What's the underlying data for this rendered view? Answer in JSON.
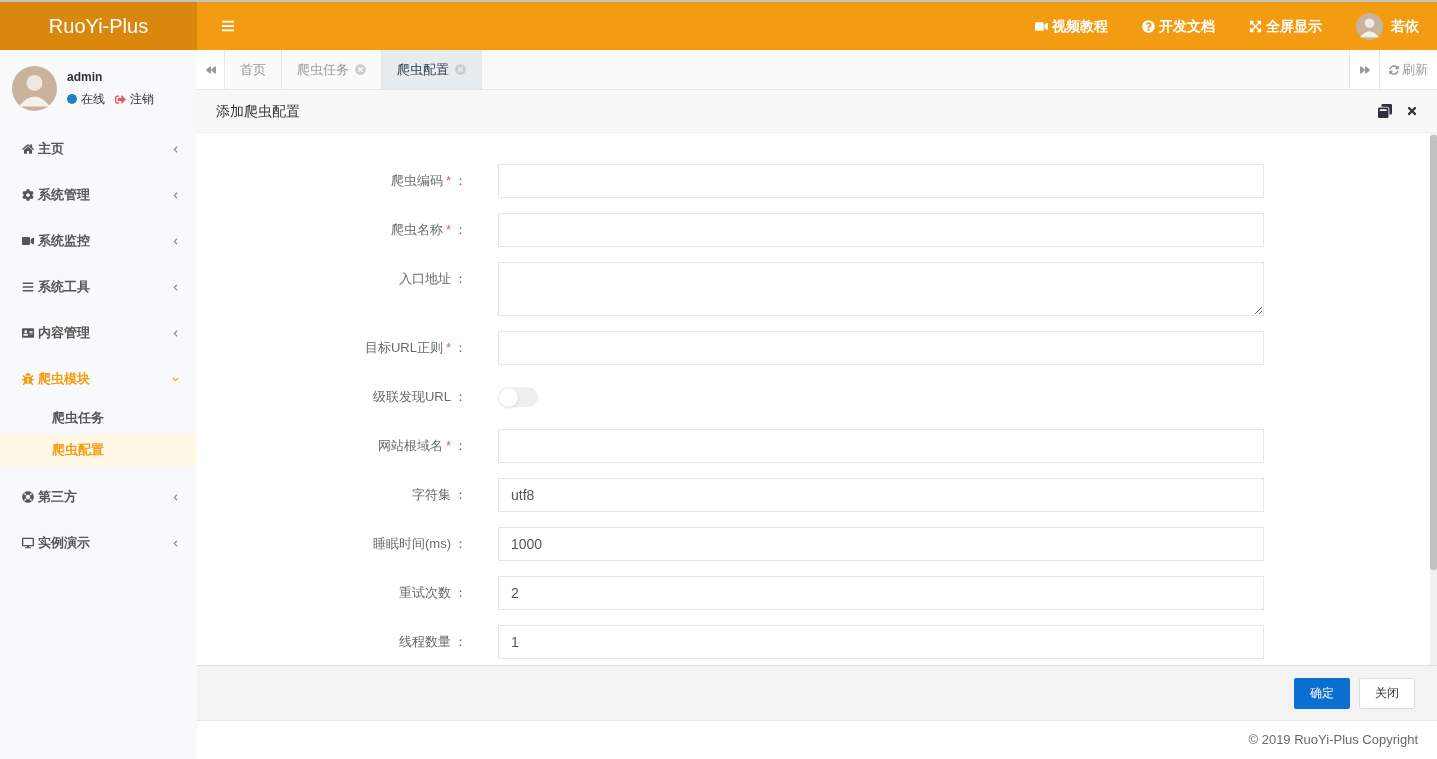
{
  "logo": "RuoYi-Plus",
  "top_menu": [
    {
      "label": "视频教程"
    },
    {
      "label": "开发文档"
    },
    {
      "label": "全屏显示"
    }
  ],
  "top_user": "若依",
  "user": {
    "name": "admin",
    "status": "在线",
    "logout": "注销"
  },
  "sidebar": [
    {
      "label": "主页",
      "expanded": false
    },
    {
      "label": "系统管理",
      "expanded": false
    },
    {
      "label": "系统监控",
      "expanded": false
    },
    {
      "label": "系统工具",
      "expanded": false
    },
    {
      "label": "内容管理",
      "expanded": false
    },
    {
      "label": "爬虫模块",
      "expanded": true,
      "children": [
        {
          "label": "爬虫任务",
          "selected": false
        },
        {
          "label": "爬虫配置",
          "selected": true
        }
      ]
    },
    {
      "label": "第三方",
      "expanded": false
    },
    {
      "label": "实例演示",
      "expanded": false
    }
  ],
  "tabs": [
    {
      "label": "首页",
      "closable": false,
      "selected": false
    },
    {
      "label": "爬虫任务",
      "closable": true,
      "selected": false
    },
    {
      "label": "爬虫配置",
      "closable": true,
      "selected": true
    }
  ],
  "refresh": "刷新",
  "dialog": {
    "title": "添加爬虫配置",
    "fields": [
      {
        "kind": "input",
        "label": "爬虫编码",
        "required_mark": "*",
        "colon": "："
      },
      {
        "kind": "input",
        "label": "爬虫名称",
        "required_mark": "*",
        "colon": "："
      },
      {
        "kind": "textarea",
        "label": "入口地址",
        "colon": "："
      },
      {
        "kind": "input",
        "label": "目标URL正则",
        "required_mark": "*",
        "colon": "："
      },
      {
        "kind": "switch",
        "label": "级联发现URL",
        "colon": "：",
        "on": false
      },
      {
        "kind": "input",
        "label": "网站根域名",
        "required_mark": "*",
        "colon": "："
      },
      {
        "kind": "input",
        "label": "字符集",
        "colon": "：",
        "value": "utf8"
      },
      {
        "kind": "input",
        "label": "睡眠时间(ms)",
        "colon": "：",
        "value": "1000"
      },
      {
        "kind": "input",
        "label": "重试次数",
        "colon": "：",
        "value": "2"
      },
      {
        "kind": "input",
        "label": "线程数量",
        "colon": "：",
        "value": "1"
      }
    ],
    "confirm": "确定",
    "close": "关闭"
  },
  "copyright": "© 2019 RuoYi-Plus Copyright"
}
